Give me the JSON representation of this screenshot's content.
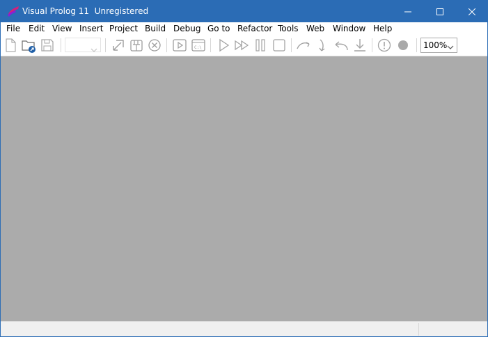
{
  "window": {
    "title": "Visual Prolog 11  Unregistered",
    "title_bar_color": "#2b6cb5",
    "workspace_color": "#ababab"
  },
  "window_controls": [
    "minimize-icon",
    "maximize-icon",
    "close-icon"
  ],
  "menubar": {
    "items": [
      "File",
      "Edit",
      "View",
      "Insert",
      "Project",
      "Build",
      "Debug",
      "Go to",
      "Refactor",
      "Tools",
      "Web",
      "Window",
      "Help"
    ]
  },
  "toolbar": {
    "icons": [
      "new-file-icon",
      "open-project-icon",
      "save-icon",
      "insert-icon",
      "build-icon",
      "stop-build-icon",
      "run-icon",
      "run-in-window-icon",
      "start-debug-icon",
      "run-fast-icon",
      "pause-icon",
      "stop-icon",
      "step-over-icon",
      "step-into-icon",
      "step-back-icon",
      "step-out-icon",
      "info-icon",
      "breakpoint-icon"
    ],
    "zoom_value": "100%"
  }
}
